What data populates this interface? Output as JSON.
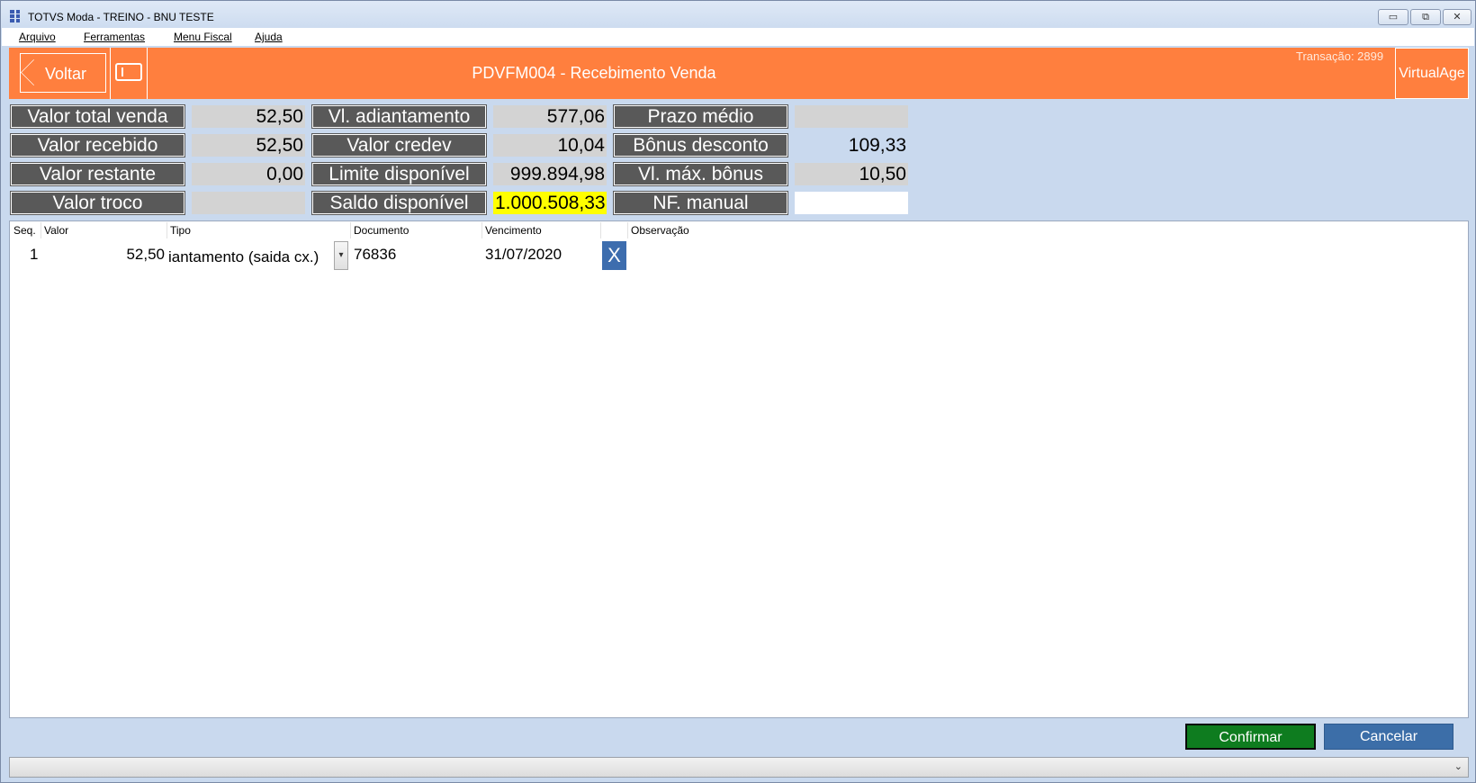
{
  "window": {
    "title": "TOTVS Moda - TREINO - BNU TESTE",
    "minimize_glyph": "▭",
    "restore_glyph": "⧉",
    "close_glyph": "✕"
  },
  "menu": {
    "items": [
      "Arquivo",
      "Ferramentas",
      "Menu Fiscal",
      "Ajuda"
    ]
  },
  "header": {
    "back_label": "Voltar",
    "title": "PDVFM004 - Recebimento Venda",
    "transaction": "Transação: 2899",
    "virtualage_label": "VirtualAge",
    "accent_color": "#ff7f3e"
  },
  "summary": {
    "valor_total_venda": {
      "label": "Valor total venda",
      "value": "52,50"
    },
    "valor_recebido": {
      "label": "Valor recebido",
      "value": "52,50"
    },
    "valor_restante": {
      "label": "Valor restante",
      "value": "0,00"
    },
    "valor_troco": {
      "label": "Valor troco",
      "value": ""
    },
    "vl_adiantamento": {
      "label": "Vl. adiantamento",
      "value": "577,06"
    },
    "valor_credev": {
      "label": "Valor credev",
      "value": "10,04"
    },
    "limite_disponivel": {
      "label": "Limite disponível",
      "value": "999.894,98"
    },
    "saldo_disponivel": {
      "label": "Saldo disponível",
      "value": "1.000.508,33"
    },
    "prazo_medio": {
      "label": "Prazo médio",
      "value": ""
    },
    "bonus_desconto": {
      "label": "Bônus desconto",
      "value": "109,33"
    },
    "vl_max_bonus": {
      "label": "Vl. máx. bônus",
      "value": "10,50"
    },
    "nf_manual": {
      "label": "NF. manual",
      "value": ""
    }
  },
  "grid": {
    "columns": [
      "Seq.",
      "Valor",
      "Tipo",
      "Documento",
      "Vencimento",
      "Observação"
    ],
    "rows": [
      {
        "seq": "1",
        "valor": "52,50",
        "tipo": "iantamento (saida cx.)",
        "documento": "76836",
        "vencimento": "31/07/2020",
        "observacao": "",
        "delete_glyph": "X"
      }
    ]
  },
  "footer": {
    "confirm_label": "Confirmar",
    "cancel_label": "Cancelar",
    "status_text": ""
  }
}
